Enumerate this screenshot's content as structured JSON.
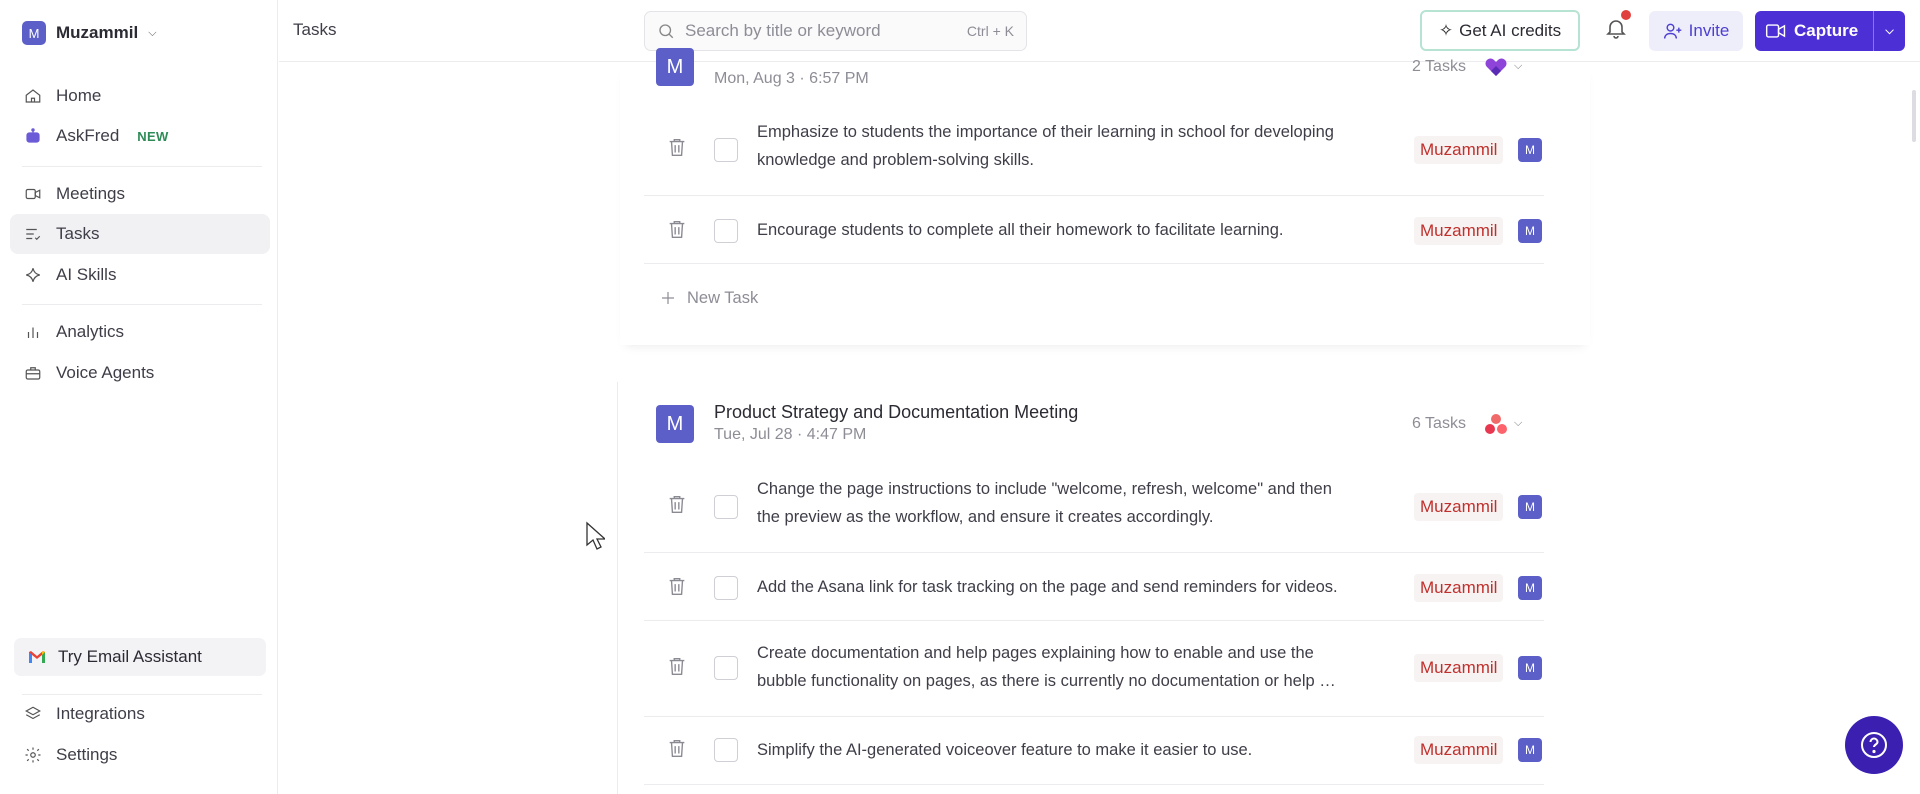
{
  "workspace": {
    "initial": "M",
    "name": "Muzammil"
  },
  "sidebar": {
    "items": [
      {
        "label": "Home",
        "icon": "home-icon"
      },
      {
        "label": "AskFred",
        "badge": "NEW",
        "icon": "robot-icon"
      },
      {
        "label": "Meetings",
        "icon": "video-icon"
      },
      {
        "label": "Tasks",
        "icon": "tasks-icon",
        "active": true
      },
      {
        "label": "AI Skills",
        "icon": "sparkle-icon"
      },
      {
        "label": "Analytics",
        "icon": "bar-chart-icon"
      },
      {
        "label": "Voice Agents",
        "icon": "briefcase-icon"
      },
      {
        "label": "Integrations",
        "icon": "layers-icon"
      },
      {
        "label": "Settings",
        "icon": "gear-icon"
      }
    ],
    "email_assistant": "Try Email Assistant"
  },
  "topbar": {
    "title": "Tasks",
    "search_placeholder": "Search by title or keyword",
    "search_shortcut": "Ctrl + K",
    "credits_label": "Get AI credits",
    "invite_label": "Invite",
    "capture_label": "Capture"
  },
  "meetings": [
    {
      "avatar": "M",
      "date": "Mon, Aug 3 · 6:57 PM",
      "task_count": "2 Tasks",
      "tasks": [
        {
          "text": "Emphasize to students the importance of their learning in school for developing knowledge and problem-solving skills.",
          "assignee": "Muzammil",
          "assignee_initial": "M"
        },
        {
          "text": "Encourage students to complete all their homework to facilitate learning.",
          "assignee": "Muzammil",
          "assignee_initial": "M"
        }
      ],
      "new_task_label": "New Task"
    },
    {
      "avatar": "M",
      "title": "Product Strategy and Documentation Meeting",
      "date": "Tue, Jul 28 · 4:47 PM",
      "task_count": "6 Tasks",
      "tasks": [
        {
          "text": "Change the page instructions to include \"welcome, refresh, welcome\" and then the preview as the workflow, and ensure it creates accordingly.",
          "assignee": "Muzammil",
          "assignee_initial": "M"
        },
        {
          "text": "Add the Asana link for task tracking on the page and send reminders for videos.",
          "assignee": "Muzammil",
          "assignee_initial": "M"
        },
        {
          "text": "Create documentation and help pages explaining how to enable and use the bubble functionality on pages, as there is currently no documentation or help …",
          "assignee": "Muzammil",
          "assignee_initial": "M"
        },
        {
          "text": "Simplify the AI-generated voiceover feature to make it easier to use.",
          "assignee": "Muzammil",
          "assignee_initial": "M"
        }
      ]
    }
  ],
  "colors": {
    "accent": "#4d2fd6",
    "avatar": "#5b5fc7",
    "assignee_text": "#c0302c",
    "help_button": "#3b1fb0"
  }
}
